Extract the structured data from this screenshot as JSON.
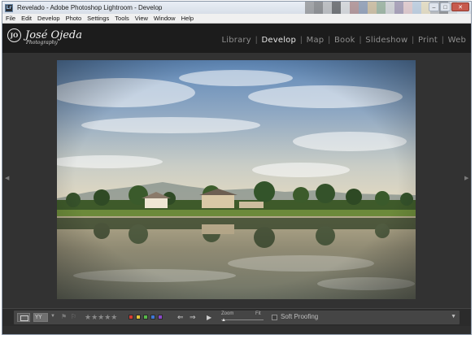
{
  "window": {
    "title": "Revelado - Adobe Photoshop Lightroom - Develop",
    "app_icon": "lightroom-icon",
    "controls": [
      "–",
      "□",
      "✕"
    ],
    "swatches": [
      "#6b6b6b",
      "#4a4a4a",
      "#9a9a9a",
      "#1a1a1a",
      "#c7c7c7",
      "#8c5a5a",
      "#5a6c8c",
      "#b69a6a",
      "#6a8c6a",
      "#bdbdbd",
      "#7a6a8c",
      "#d8b0b0",
      "#a0b8d0",
      "#e0d0a0",
      "#999999",
      "#555555",
      "#cccccc"
    ]
  },
  "menubar": {
    "items": [
      "File",
      "Edit",
      "Develop",
      "Photo",
      "Settings",
      "Tools",
      "View",
      "Window",
      "Help"
    ]
  },
  "identity_plate": {
    "mark": "JO",
    "name": "José Ojeda",
    "tagline": "Photography"
  },
  "modules": {
    "items": [
      "Library",
      "Develop",
      "Map",
      "Book",
      "Slideshow",
      "Print",
      "Web"
    ],
    "active": "Develop"
  },
  "photo": {
    "description_icon": "landscape-photo",
    "sky_top": "#5f88b8",
    "sky_mid": "#aebfcf",
    "horizon": "#e8dcc0",
    "water": "#8f8a73"
  },
  "toolbar": {
    "compare_label": "YY",
    "stars": "★★★★★",
    "color_labels": [
      "#d13b32",
      "#e0c53a",
      "#58b94a",
      "#3f77d4",
      "#8b47c9"
    ],
    "zoom_label": "Zoom",
    "fit_label": "Fit",
    "soft_proofing_label": "Soft Proofing",
    "menu_glyph": "▼"
  },
  "accent": {
    "active_module": "#e6e6e6",
    "inactive_module": "#8e8e8e"
  }
}
